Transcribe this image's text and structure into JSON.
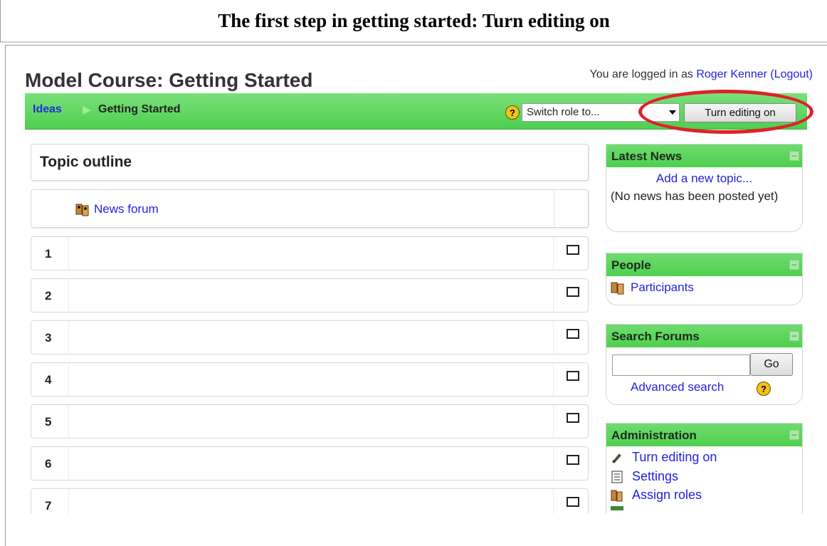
{
  "caption": "The first step in getting started: Turn editing on",
  "course": {
    "title": "Model Course: Getting Started"
  },
  "login": {
    "prefix": "You are logged in as",
    "user": "Roger Kenner",
    "logout": "(Logout)"
  },
  "breadcrumb": {
    "root": "Ideas",
    "separator": "▶",
    "current": "Getting Started"
  },
  "navbar": {
    "role_select": "Switch role to...",
    "edit_button": "Turn editing on",
    "help": "?"
  },
  "main": {
    "topic_outline": "Topic outline",
    "news_forum": "News forum",
    "weeks": [
      "1",
      "2",
      "3",
      "4",
      "5",
      "6",
      "7"
    ]
  },
  "blocks": {
    "latest_news": {
      "title": "Latest News",
      "add_topic": "Add a new topic...",
      "empty": "(No news has been posted yet)",
      "toggle": "–"
    },
    "people": {
      "title": "People",
      "participants": "Participants",
      "toggle": "–"
    },
    "search_forums": {
      "title": "Search Forums",
      "go": "Go",
      "advanced": "Advanced search",
      "toggle": "–"
    },
    "administration": {
      "title": "Administration",
      "toggle": "–",
      "items": [
        "Turn editing on",
        "Settings",
        "Assign roles"
      ]
    }
  },
  "colors": {
    "nav_green": "#4fcf4f",
    "link_blue": "#2222dd",
    "highlight_red": "#e0202a"
  }
}
